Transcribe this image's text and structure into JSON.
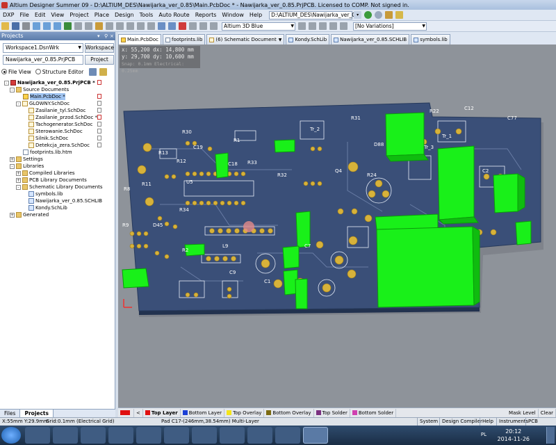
{
  "title_bar": {
    "text": "Altium Designer Summer 09 - D:\\ALTIUM_DES\\Nawijarka_ver_0.85\\Main.PcbDoc * - Nawijarka_ver_0.85.PrjPCB. Licensed to COMP. Not signed in."
  },
  "menu": {
    "items": [
      "DXP",
      "File",
      "Edit",
      "View",
      "Project",
      "Place",
      "Design",
      "Tools",
      "Auto Route",
      "Reports",
      "Window",
      "Help"
    ],
    "path": "D:\\ALTIUM_DES\\Nawijarka_ver_0.8"
  },
  "toolbar": {
    "view_config": "Altium 3D Blue",
    "variations": "[No Variations]"
  },
  "projects_panel": {
    "title": "Projects",
    "workspace": "Workspace1.DsnWrk",
    "workspace_button": "Workspace",
    "project": "Nawijarka_ver_0.85.PrjPCB",
    "project_button": "Project",
    "file_view": "File View",
    "structure_editor": "Structure Editor",
    "tree": [
      {
        "label": "Nawijarka_ver_0.85.PrjPCB *",
        "icon": "project-icon"
      },
      {
        "label": "Source Documents",
        "icon": "folder-icon"
      },
      {
        "label": "Main.PcbDoc *",
        "icon": "pcb-doc-icon"
      },
      {
        "label": "GLOWNY.SchDoc",
        "icon": "sch-doc-icon"
      },
      {
        "label": "Zasilanie_tyl.SchDoc",
        "icon": "sch-doc-icon"
      },
      {
        "label": "Zasilanie_przod.SchDoc *",
        "icon": "sch-doc-icon"
      },
      {
        "label": "Tachogenerator.SchDoc",
        "icon": "sch-doc-icon"
      },
      {
        "label": "Sterowanie.SchDoc",
        "icon": "sch-doc-icon"
      },
      {
        "label": "Silnik.SchDoc",
        "icon": "sch-doc-icon"
      },
      {
        "label": "Detekcja_zera.SchDoc",
        "icon": "sch-doc-icon"
      },
      {
        "label": "footprints.lib.htm",
        "icon": "doc-icon"
      },
      {
        "label": "Settings",
        "icon": "folder-icon"
      },
      {
        "label": "Libraries",
        "icon": "folder-icon"
      },
      {
        "label": "Compiled Libraries",
        "icon": "folder-icon"
      },
      {
        "label": "PCB Library Documents",
        "icon": "folder-icon"
      },
      {
        "label": "Schematic Library Documents",
        "icon": "folder-icon"
      },
      {
        "label": "symbols.lib",
        "icon": "lib-icon"
      },
      {
        "label": "Nawijarka_ver_0.85.SCHLIB",
        "icon": "lib-icon"
      },
      {
        "label": "Kondy.SchLib",
        "icon": "lib-icon"
      },
      {
        "label": "Generated",
        "icon": "folder-icon"
      }
    ],
    "tabs": [
      "Files",
      "Projects"
    ]
  },
  "doc_tabs": [
    {
      "label": "Main.PcbDoc",
      "icon": "pcb-doc-icon"
    },
    {
      "label": "footprints.lib",
      "icon": "doc-icon"
    },
    {
      "label": "(6) Schematic Document",
      "icon": "sch-doc-icon"
    },
    {
      "label": "Kondy.SchLib",
      "icon": "lib-icon"
    },
    {
      "label": "Nawijarka_ver_0.85.SCHLIB",
      "icon": "lib-icon"
    },
    {
      "label": "symbols.lib",
      "icon": "lib-icon"
    }
  ],
  "coords": {
    "line1": "x: 55,200   dx: 14,800 mm",
    "line2": "y: 29,700   dy: 10,600 mm",
    "line3": "Snap: 0.1mm Electrical: 0.25mm"
  },
  "pcb_labels": [
    "R30",
    "C19",
    "R1",
    "C18",
    "R33",
    "R13",
    "R12",
    "R31",
    "Tr_2",
    "R22",
    "C12",
    "C77",
    "Tr_1",
    "D88",
    "R24",
    "C2",
    "R11",
    "R32",
    "Q4",
    "R8",
    "R34",
    "U5",
    "D45",
    "R2",
    "L9",
    "C9",
    "C7",
    "C1",
    "Tr_3",
    "R9"
  ],
  "layer_tabs": [
    {
      "label": "Top Layer",
      "color": "#e01010"
    },
    {
      "label": "Bottom Layer",
      "color": "#1a3fd6"
    },
    {
      "label": "Top Overlay",
      "color": "#f4e51a"
    },
    {
      "label": "Bottom Overlay",
      "color": "#7b6a12"
    },
    {
      "label": "Top Solder",
      "color": "#7a3080"
    },
    {
      "label": "Bottom Solder",
      "color": "#d040b0"
    }
  ],
  "layer_right": {
    "mask_level": "Mask Level",
    "clear": "Clear"
  },
  "status": {
    "coords": "X:55mm Y:29.9mm",
    "grid": "Grid:0.1mm",
    "grid_type": "(Electrical Grid)",
    "pad": "Pad C17-(246mm,38.54mm) Multi-Layer",
    "buttons": [
      "System",
      "Design Compiler",
      "Help",
      "Instruments",
      "PCB"
    ]
  },
  "taskbar": {
    "lang": "PL",
    "time": "20:12",
    "date": "2014-11-26"
  },
  "colors": {
    "pcb_board": "#3a4f78",
    "component_green": "#19f019",
    "pad_gold": "#d7b23a"
  }
}
